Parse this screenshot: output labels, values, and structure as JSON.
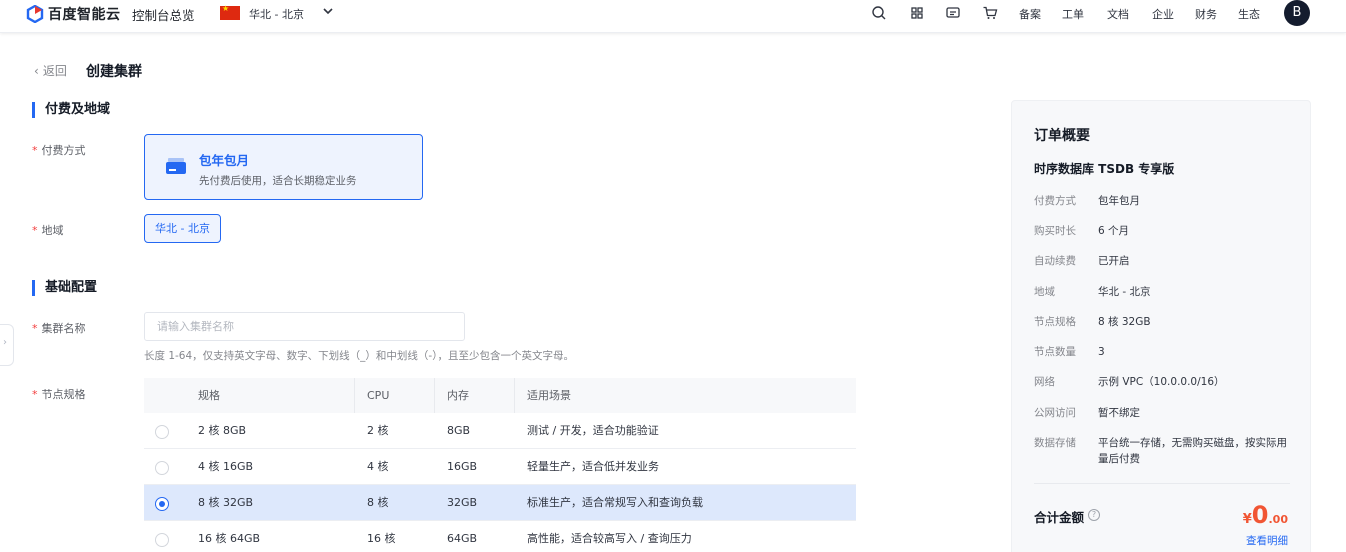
{
  "header": {
    "brand": "百度智能云",
    "console_overview": "控制台总览",
    "region": "华北 - 北京",
    "nav_items": [
      "备案",
      "工单",
      "文档",
      "企业",
      "财务",
      "生态"
    ],
    "avatar_initial": "B"
  },
  "page": {
    "back_label": "返回",
    "title": "创建集群"
  },
  "billing_section": {
    "title": "付费及地域",
    "payment_label": "付费方式",
    "payment_option": {
      "title": "包年包月",
      "desc": "先付费后使用，适合长期稳定业务"
    },
    "region_label": "地域",
    "region_value": "华北 - 北京"
  },
  "basic_section": {
    "title": "基础配置",
    "cluster_name_label": "集群名称",
    "cluster_name_placeholder": "请输入集群名称",
    "cluster_name_hint": "长度 1-64，仅支持英文字母、数字、下划线（_）和中划线（-），且至少包含一个英文字母。",
    "node_spec_label": "节点规格",
    "table": {
      "columns": [
        "规格",
        "CPU",
        "内存",
        "适用场景"
      ],
      "rows": [
        {
          "spec": "2 核 8GB",
          "cpu": "2 核",
          "mem": "8GB",
          "use": "测试 / 开发，适合功能验证",
          "selected": false
        },
        {
          "spec": "4 核 16GB",
          "cpu": "4 核",
          "mem": "16GB",
          "use": "轻量生产，适合低并发业务",
          "selected": false
        },
        {
          "spec": "8 核 32GB",
          "cpu": "8 核",
          "mem": "32GB",
          "use": "标准生产，适合常规写入和查询负载",
          "selected": true
        },
        {
          "spec": "16 核 64GB",
          "cpu": "16 核",
          "mem": "64GB",
          "use": "高性能，适合较高写入 / 查询压力",
          "selected": false
        }
      ]
    }
  },
  "summary": {
    "title": "订单概要",
    "product": "时序数据库 TSDB 专享版",
    "rows": [
      {
        "key": "付费方式",
        "value": "包年包月"
      },
      {
        "key": "购买时长",
        "value": "6 个月"
      },
      {
        "key": "自动续费",
        "value": "已开启"
      },
      {
        "key": "地域",
        "value": "华北 - 北京"
      },
      {
        "key": "节点规格",
        "value": "8 核 32GB"
      },
      {
        "key": "节点数量",
        "value": "3"
      },
      {
        "key": "网络",
        "value": "示例 VPC（10.0.0.0/16）"
      },
      {
        "key": "公网访问",
        "value": "暂不绑定"
      },
      {
        "key": "数据存储",
        "value": "平台统一存储，无需购买磁盘，按实际用量后付费"
      }
    ],
    "total_label": "合计金额",
    "price_currency": "¥",
    "price_integer": "0",
    "price_decimal": ".00",
    "detail_link": "查看明细"
  },
  "colors": {
    "primary": "#2468f2",
    "price": "#f15533",
    "selected_row": "#dde8fc"
  }
}
